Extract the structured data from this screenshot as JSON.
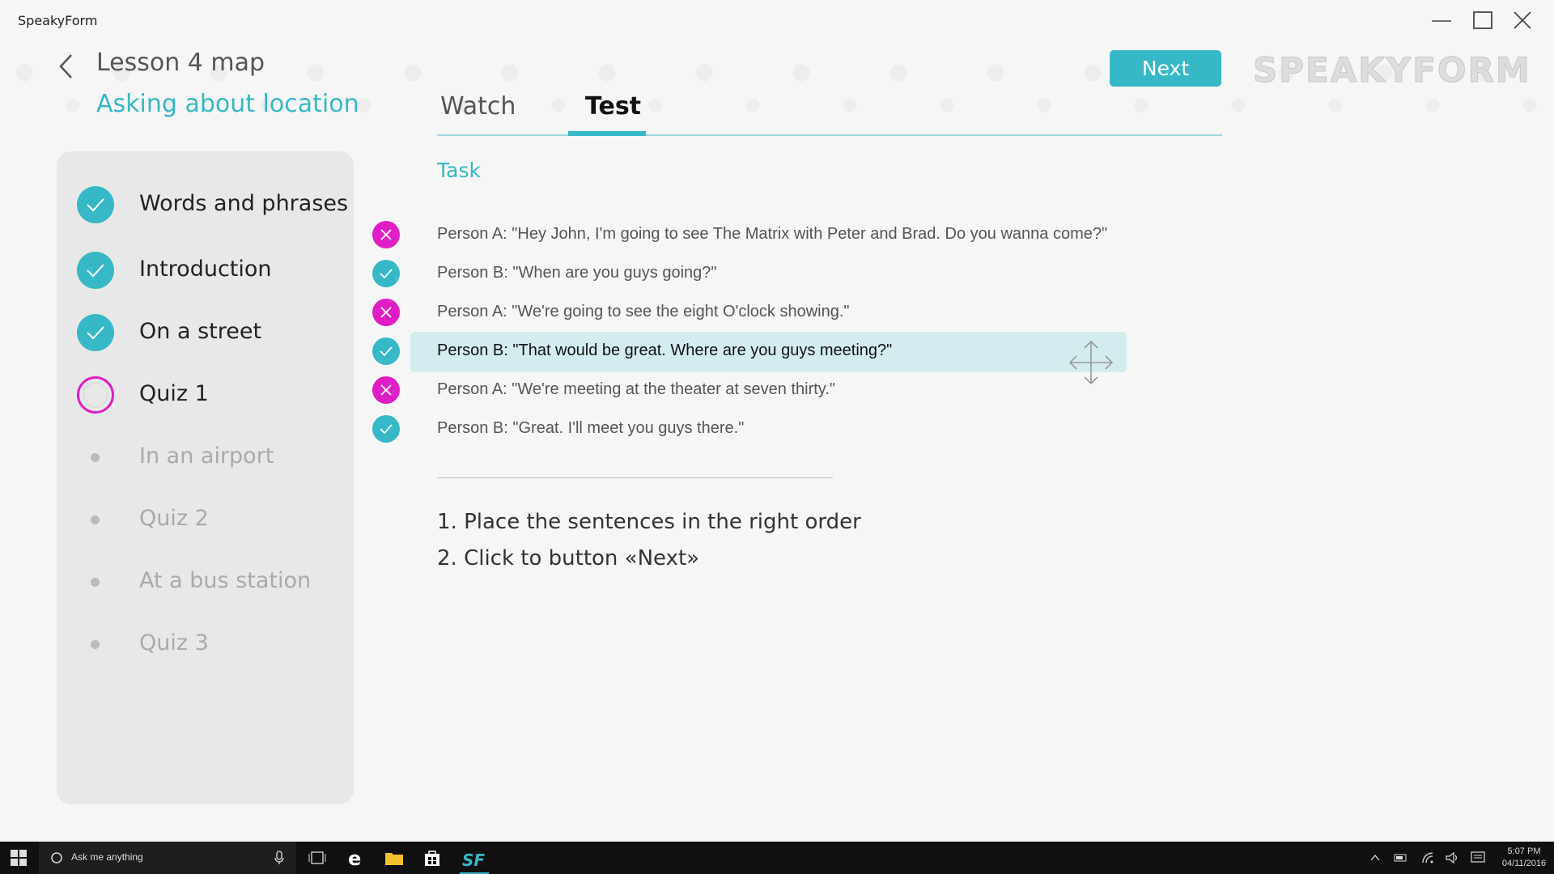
{
  "window": {
    "app_title": "SpeakyForm"
  },
  "header": {
    "lesson_title": "Lesson 4 map",
    "subtitle": "Asking about location",
    "tabs": [
      {
        "label": "Watch",
        "active": false
      },
      {
        "label": "Test",
        "active": true
      }
    ],
    "next_label": "Next",
    "logo_text": "SPEAKYFORM"
  },
  "sidebar": {
    "items": [
      {
        "label": "Words and phrases",
        "state": "done"
      },
      {
        "label": "Introduction",
        "state": "done"
      },
      {
        "label": "On a street",
        "state": "done"
      },
      {
        "label": "Quiz 1",
        "state": "current"
      },
      {
        "label": "In an airport",
        "state": "locked"
      },
      {
        "label": "Quiz 2",
        "state": "locked"
      },
      {
        "label": "At a bus station",
        "state": "locked"
      },
      {
        "label": "Quiz 3",
        "state": "locked"
      }
    ]
  },
  "task": {
    "title": "Task",
    "sentences": [
      {
        "text": "Person A: \"Hey John, I'm going to see The Matrix with Peter and Brad. Do you wanna come?\"",
        "status": "wrong"
      },
      {
        "text": "Person B: \"When are you guys going?\"",
        "status": "correct"
      },
      {
        "text": "Person A: \"We're going to see the eight O'clock showing.\"",
        "status": "wrong"
      },
      {
        "text": "Person B: \"That would be great. Where are you guys meeting?\"",
        "status": "correct",
        "selected": true
      },
      {
        "text": "Person A: \"We're meeting at the theater at seven thirty.\"",
        "status": "wrong"
      },
      {
        "text": "Person B: \"Great. I'll meet you guys there.\"",
        "status": "correct"
      }
    ],
    "instructions": [
      "1. Place the sentences in the right order",
      "2. Click to button «Next»"
    ]
  },
  "taskbar": {
    "search_placeholder": "Ask me anything",
    "time": "5:07 PM",
    "date": "04/11/2016"
  },
  "colors": {
    "accent": "#36b8c6",
    "wrong": "#e01ec6",
    "selected_bg": "#d3ecef"
  }
}
